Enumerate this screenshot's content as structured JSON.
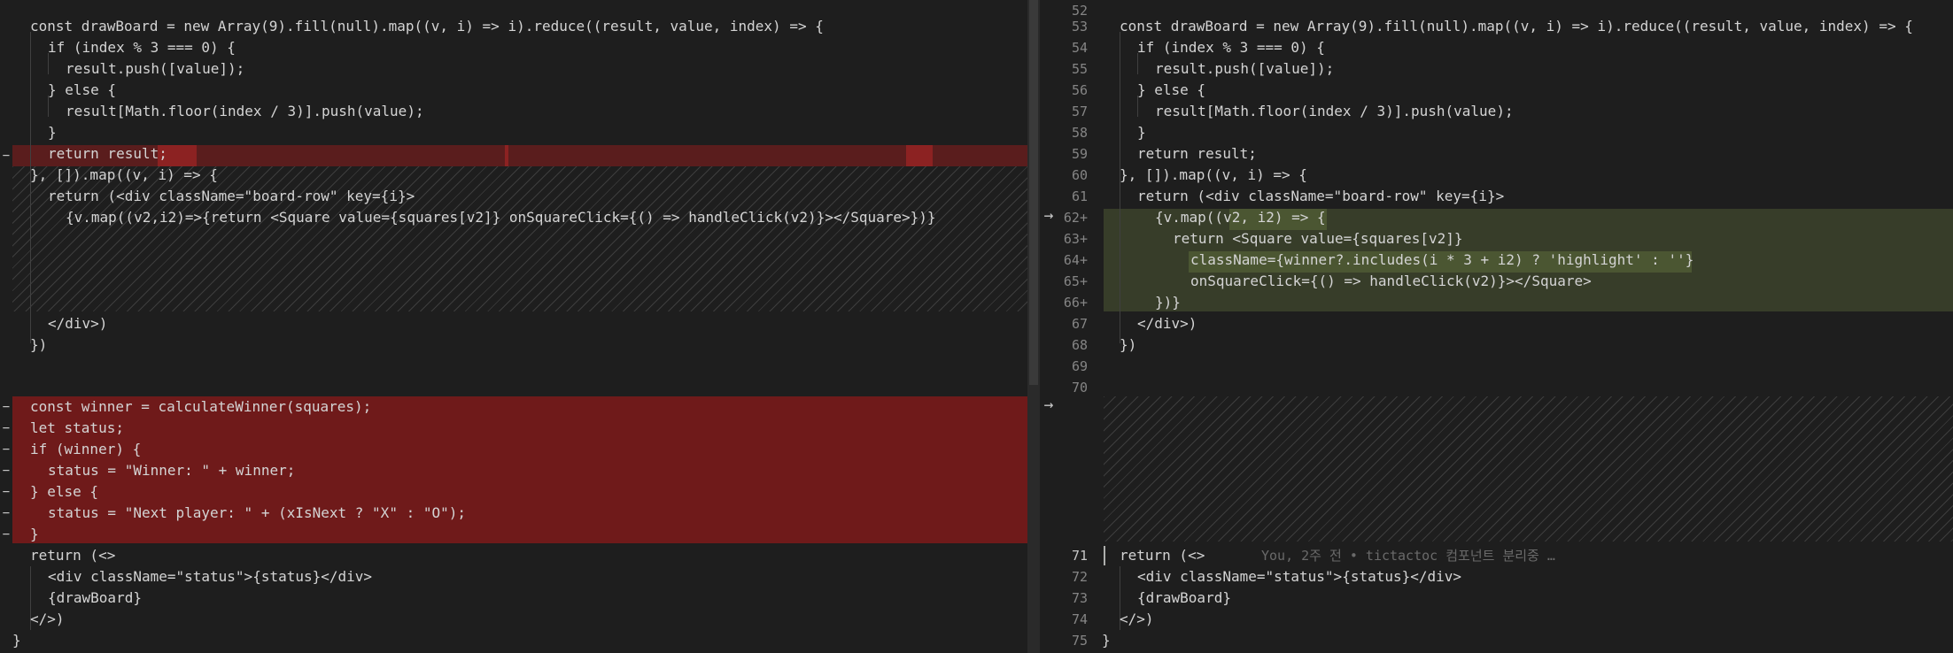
{
  "left": {
    "lines": [
      [
        "const ",
        "drawBoard",
        " = ",
        "new ",
        "Array",
        "(9).",
        "fill",
        "(null).",
        "map",
        "((",
        "v",
        ", ",
        "i",
        ") => ",
        "i",
        ").",
        "reduce",
        "((",
        "result",
        ", ",
        "value",
        ", ",
        "index",
        ") => {"
      ],
      [
        "if (index % 3 === 0) {"
      ],
      [
        "result.push([value]);"
      ],
      [
        "} else {"
      ],
      [
        "result[Math.floor(index / 3)].push(value);"
      ],
      [
        "}"
      ],
      [
        "return result;"
      ],
      [
        "}, []).map((v, i) => {"
      ],
      [
        "return (<div className=\"board-row\" key={i}>"
      ],
      [
        "{v.map((v2,i2)=>{return <Square value={squares[v2]} onSquareClick={() => handleClick(v2)}></Square>})}"
      ],
      [
        "</div>)"
      ],
      [
        "})"
      ],
      [
        "const winner = calculateWinner(squares);"
      ],
      [
        "let status;"
      ],
      [
        "if (winner) {"
      ],
      [
        "status = \"Winner: \" + winner;"
      ],
      [
        "} else {"
      ],
      [
        "status = \"Next player: \" + (xIsNext ? \"X\" : \"O\");"
      ],
      [
        "}"
      ],
      [
        "return (<>"
      ],
      [
        "<div className=\"status\">{status}</div>"
      ],
      [
        "{drawBoard}"
      ],
      [
        "</>)"
      ],
      [
        "}"
      ]
    ],
    "removed_marker": "−"
  },
  "right": {
    "line_numbers": [
      "52",
      "53",
      "54",
      "55",
      "56",
      "57",
      "58",
      "59",
      "60",
      "61",
      "62+",
      "63+",
      "64+",
      "65+",
      "66+",
      "67",
      "68",
      "69",
      "70",
      "71",
      "72",
      "73",
      "74",
      "75"
    ],
    "blame": "You, 2주 전 • tictactoc 컴포넌트 분리중 …",
    "added_lines": {
      "l62": "{v.map((v2, i2) => {",
      "l63": "return <Square value={squares[v2]}",
      "l64": "className={winner?.includes(i * 3 + i2) ? 'highlight' : ''}",
      "l65": "onSquareClick={() => handleClick(v2)}></Square>",
      "l66": "})}"
    }
  },
  "gutter": {
    "arrow": "→"
  },
  "colors": {
    "background": "#1e1e1e",
    "removed": "#6f1a1a",
    "added": "#373d29",
    "keyword": "#569cd6",
    "string": "#ce9178",
    "function": "#dcdcaa",
    "variable": "#9cdcfe"
  }
}
